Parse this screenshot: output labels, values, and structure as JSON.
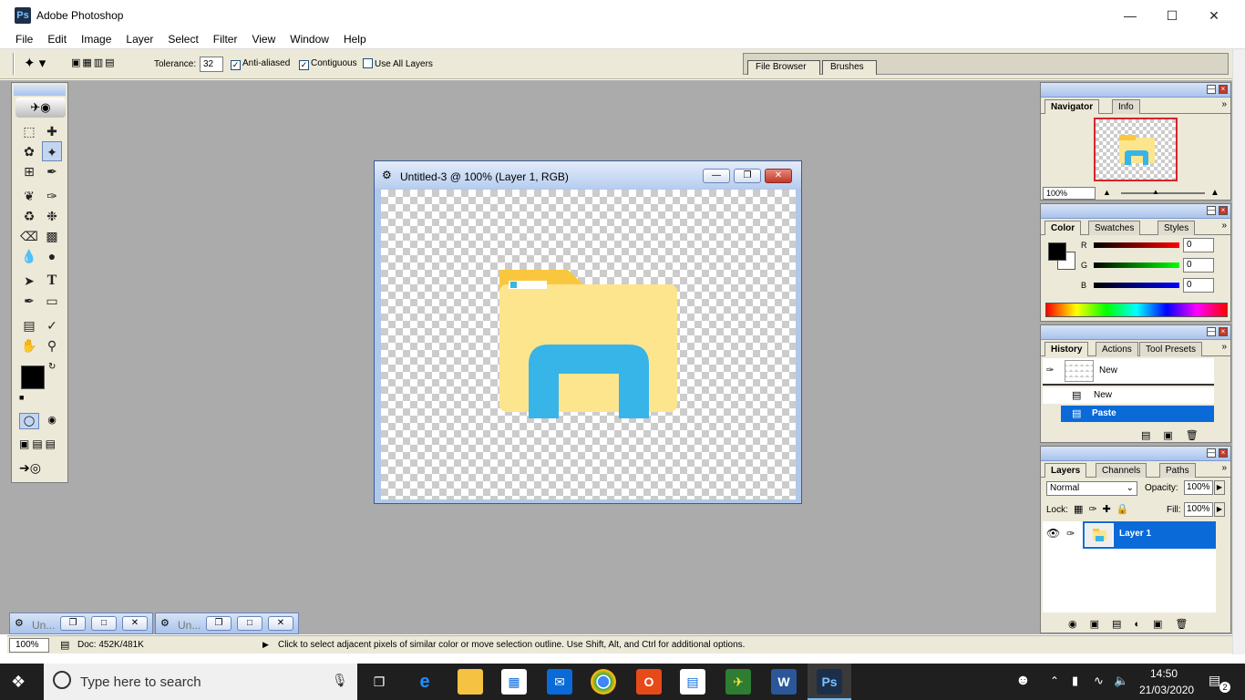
{
  "app": {
    "title": "Adobe Photoshop"
  },
  "menu": [
    "File",
    "Edit",
    "Image",
    "Layer",
    "Select",
    "Filter",
    "View",
    "Window",
    "Help"
  ],
  "options": {
    "tolerance_label": "Tolerance:",
    "tolerance_value": "32",
    "anti_aliased": "Anti-aliased",
    "contiguous": "Contiguous",
    "use_all_layers": "Use All Layers",
    "well_tabs": [
      "File Browser",
      "Brushes"
    ]
  },
  "document": {
    "title": "Untitled-3 @ 100% (Layer 1, RGB)"
  },
  "navigator": {
    "tabs": [
      "Navigator",
      "Info"
    ],
    "zoom": "100%"
  },
  "color": {
    "tabs": [
      "Color",
      "Swatches",
      "Styles"
    ],
    "r_label": "R",
    "g_label": "G",
    "b_label": "B",
    "r": "0",
    "g": "0",
    "b": "0"
  },
  "history": {
    "tabs": [
      "History",
      "Actions",
      "Tool Presets"
    ],
    "snapshot": "New",
    "items": [
      "New",
      "Paste"
    ]
  },
  "layers": {
    "tabs": [
      "Layers",
      "Channels",
      "Paths"
    ],
    "blend_mode": "Normal",
    "opacity_label": "Opacity:",
    "opacity": "100%",
    "lock_label": "Lock:",
    "fill_label": "Fill:",
    "fill": "100%",
    "layer_name": "Layer 1"
  },
  "minimized_docs": [
    "Un...",
    "Un..."
  ],
  "status": {
    "zoom": "100%",
    "doc": "Doc: 452K/481K",
    "hint": "Click to select adjacent pixels of similar color or move selection outline.  Use Shift, Alt, and Ctrl for additional options."
  },
  "taskbar": {
    "search_placeholder": "Type here to search",
    "time": "14:50",
    "date": "21/03/2020",
    "notifications": "2"
  },
  "colors": {
    "accent": "#0a6ad8",
    "folder_yellow": "#fde58e",
    "folder_tab": "#f9c73d",
    "folder_blue": "#37b4e8"
  }
}
